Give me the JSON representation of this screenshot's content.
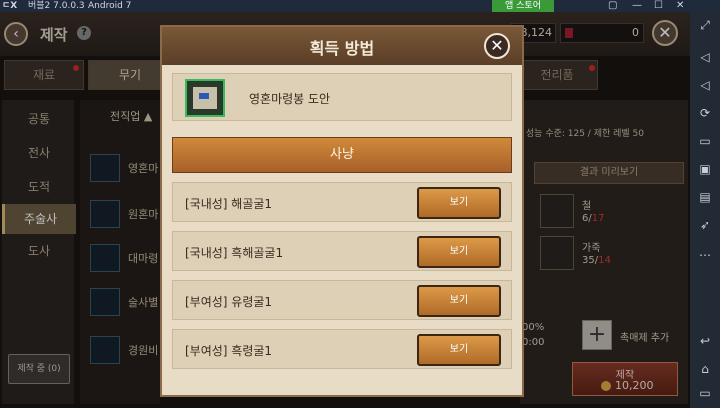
{
  "emulator": {
    "logo": "ㄷX",
    "title": "버블2 7.0.0.3",
    "android": "Android 7",
    "store": "앱 스토어",
    "controls": [
      "▢",
      "—",
      "☐",
      "✕"
    ]
  },
  "header": {
    "back": "‹",
    "title": "제작",
    "help": "?",
    "currency_1": "8,124",
    "currency_2": "0",
    "close": "✕"
  },
  "tabs": [
    {
      "label": "재료",
      "dot": true
    },
    {
      "label": "무기",
      "dot": true
    },
    {
      "label": "전리품",
      "dot": true
    }
  ],
  "classes": [
    "공통",
    "전사",
    "도적",
    "주술사",
    "도사"
  ],
  "active_class": "주술사",
  "craft_history": "제작 중 (0)",
  "item_list": {
    "sort_label": "전직업 ▲",
    "items": [
      "영혼마",
      "원혼마",
      "대마령",
      "술사별",
      "경원비"
    ]
  },
  "details": {
    "info": "/ 성능 수준: 125 / 제한 레벨 50",
    "preview_tab": "결과 미리보기",
    "materials": [
      {
        "name": "철",
        "have": "6/",
        "need": "17"
      },
      {
        "name": "가죽",
        "have": "35/",
        "need": "14"
      }
    ],
    "percent": "00%",
    "time": "0:00",
    "add_catalyst": "촉매제 추가",
    "craft_label": "제작",
    "craft_cost": "10,200"
  },
  "modal": {
    "title": "획득 방법",
    "close": "✕",
    "target_name": "영혼마령봉 도안",
    "section": "사냥",
    "sources": [
      {
        "name": "[국내성] 해골굴1",
        "button": "보기"
      },
      {
        "name": "[국내성] 흑해골굴1",
        "button": "보기"
      },
      {
        "name": "[부여성] 유령굴1",
        "button": "보기"
      },
      {
        "name": "[부여성] 흑령굴1",
        "button": "보기"
      }
    ]
  },
  "colors": {
    "accent": "#b06a28",
    "modal_header": "#6a4a30",
    "modal_body": "#e8dcc6",
    "required_red": "#d03a3a",
    "rarity_green": "#3aba5a"
  }
}
